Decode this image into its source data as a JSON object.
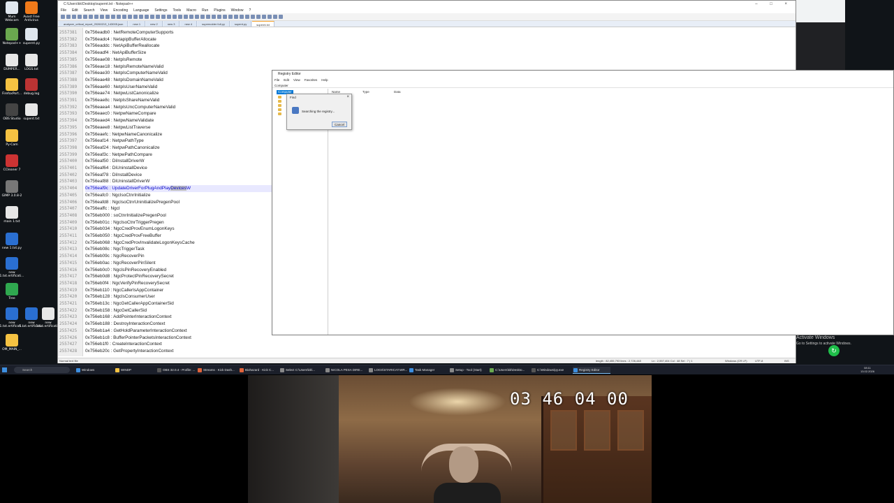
{
  "desktop": {
    "icons": [
      {
        "label": "Mum\nWebcam",
        "color": "#dfe6ee"
      },
      {
        "label": "Avast Free\nAntivirus",
        "color": "#f07a1a"
      },
      {
        "label": "Notepad++",
        "color": "#6aa84f"
      },
      {
        "label": "supernt.py",
        "color": "#dfe6ee"
      },
      {
        "label": "DUMPER...",
        "color": "#e7e7e7"
      },
      {
        "label": "LOGS.txt",
        "color": "#e7e7e7"
      },
      {
        "label": "FirefoxPort...",
        "color": "#f5c242"
      },
      {
        "label": "debug.log",
        "color": "#b33"
      },
      {
        "label": "OBS Studio",
        "color": "#444"
      },
      {
        "label": "supent.txt",
        "color": "#e7e7e7"
      },
      {
        "label": "Py-Cam",
        "color": "#f5c242"
      },
      {
        "label": "CCleaner 7",
        "color": "#c33"
      },
      {
        "label": "GIMP 3.0.8-2",
        "color": "#777"
      },
      {
        "label": "main 1.txt",
        "color": "#e7e7e7"
      },
      {
        "label": "new 1.txt.py",
        "color": "#2a6fd1"
      },
      {
        "label": "new\n1.txt.ertificati...",
        "color": "#2a6fd1"
      },
      {
        "label": "Tree",
        "color": "#2fa84f"
      },
      {
        "label": "new\n1.txt.ertificati...",
        "color": "#2a6fd1"
      },
      {
        "label": "new\n1.txt.ertificati...",
        "color": "#2a6fd1"
      },
      {
        "label": "new\n1.txt.ertificati...",
        "color": "#e7e7e7"
      },
      {
        "label": "OM_MAIN_...",
        "color": "#f5c242"
      }
    ],
    "activate_title": "Activate Windows",
    "activate_sub": "Go to Settings to activate Windows."
  },
  "notepad": {
    "title": "C:\\Users\\kk\\Desktop\\supernt.txt - Notepad++",
    "menu": [
      "File",
      "Edit",
      "Search",
      "View",
      "Encoding",
      "Language",
      "Settings",
      "Tools",
      "Macro",
      "Run",
      "Plugins",
      "Window",
      "?"
    ],
    "tabs": [
      {
        "label": "analyzer_critical_report_20260213_143005.json",
        "active": false
      },
      {
        "label": "new 1",
        "active": false
      },
      {
        "label": "new 2",
        "active": false
      },
      {
        "label": "new 3",
        "active": false
      },
      {
        "label": "new 4",
        "active": false
      },
      {
        "label": "supernolder full.py",
        "active": false
      },
      {
        "label": "supent.py",
        "active": false
      },
      {
        "label": "supernt.txt",
        "active": true
      }
    ],
    "lines": [
      {
        "n": "2557381",
        "t": "0x756eadb0 : NetRemoteComputerSupports"
      },
      {
        "n": "2557382",
        "t": "0x756eadc4 : NetapipBufferAllocate"
      },
      {
        "n": "2557383",
        "t": "0x756eaddc : NetApiBufferReallocate"
      },
      {
        "n": "2557384",
        "t": "0x756eadf4 : NetApiBufferSize"
      },
      {
        "n": "2557385",
        "t": "0x756eae08 : NetpIsRemote"
      },
      {
        "n": "2557386",
        "t": "0x756eae18 : NetpIsRemoteNameValid"
      },
      {
        "n": "2557387",
        "t": "0x756eae30 : NetpIsComputerNameValid"
      },
      {
        "n": "2557388",
        "t": "0x756eae48 : NetpIsDomainNameValid"
      },
      {
        "n": "2557389",
        "t": "0x756eae60 : NetpIsUserNameValid"
      },
      {
        "n": "2557390",
        "t": "0x756eae74 : NetpwListCanonicalize"
      },
      {
        "n": "2557391",
        "t": "0x756eae8c : NetpIsShareNameValid"
      },
      {
        "n": "2557392",
        "t": "0x756eaea4 : NetpIsUncComputerNameValid"
      },
      {
        "n": "2557393",
        "t": "0x756eaec0 : NetpwNameCompare"
      },
      {
        "n": "2557394",
        "t": "0x756eaed4 : NetpwNameValidate"
      },
      {
        "n": "2557395",
        "t": "0x756eaee8 : NetpwListTraverse"
      },
      {
        "n": "2557396",
        "t": "0x756eaefc : NetpwNameCanonicalize"
      },
      {
        "n": "2557397",
        "t": "0x756eaf14 : NetpwPathType"
      },
      {
        "n": "2557398",
        "t": "0x756eaf24 : NetpwPathCanonicalize"
      },
      {
        "n": "2557399",
        "t": "0x756eaf3c : NetpwPathCompare"
      },
      {
        "n": "2557400",
        "t": "0x756eaf50 : DiInstallDriverW"
      },
      {
        "n": "2557401",
        "t": "0x756eaf64 : DiUninstallDevice"
      },
      {
        "n": "2557402",
        "t": "0x756eaf78 : DiInstallDevice"
      },
      {
        "n": "2557403",
        "t": "0x756eaf88 : DiUninstallDriverW"
      },
      {
        "n": "2557404",
        "t": "0x756eaf9c : UpdateDriverForPlugAndPlayDevicesW"
      },
      {
        "n": "2557405",
        "t": "0x756eafc0 : NgcIsoCtnrInitialize"
      },
      {
        "n": "2557406",
        "t": "0x756eafd8 : NgcIsoCtnrUninitializePregenPool"
      },
      {
        "n": "2557407",
        "t": "0x756eaffc : NgcI"
      },
      {
        "n": "2557408",
        "t": "0x756eb000 : soCtnrInitializePregenPool"
      },
      {
        "n": "2557409",
        "t": "0x756eb01c : NgcIsoCtnrTriggerPregen"
      },
      {
        "n": "2557410",
        "t": "0x756eb034 : NgcCredProvEnumLogonKeys"
      },
      {
        "n": "2557411",
        "t": "0x756eb050 : NgcCredProvFreeBuffer"
      },
      {
        "n": "2557412",
        "t": "0x756eb068 : NgcCredProvInvalidateLogonKeysCache"
      },
      {
        "n": "2557413",
        "t": "0x756eb08c : NgcTriggerTask"
      },
      {
        "n": "2557414",
        "t": "0x756eb09c : NgcRecoverPin"
      },
      {
        "n": "2557415",
        "t": "0x756eb0ac : NgcRecoverPinSilent"
      },
      {
        "n": "2557416",
        "t": "0x756eb0c0 : NgcIsPinRecoveryEnabled"
      },
      {
        "n": "2557417",
        "t": "0x756eb0d8 : NgcProtectPinRecoverySecret"
      },
      {
        "n": "2557418",
        "t": "0x756eb0f4 : NgcVerifyPinRecoverySecret"
      },
      {
        "n": "2557419",
        "t": "0x756eb110 : NgcCallerIsAppContainer"
      },
      {
        "n": "2557420",
        "t": "0x756eb128 : NgcIsConsumerUser"
      },
      {
        "n": "2557421",
        "t": "0x756eb13c : NgcGetCallerAppContainerSid"
      },
      {
        "n": "2557422",
        "t": "0x756eb158 : NgcGetCallerSid"
      },
      {
        "n": "2557423",
        "t": "0x756eb168 : AddPointerInteractionContext"
      },
      {
        "n": "2557424",
        "t": "0x756eb188 : DestroyInteractionContext"
      },
      {
        "n": "2557425",
        "t": "0x756eb1a4 : GetHoldParameterInteractionContext"
      },
      {
        "n": "2557426",
        "t": "0x756eb1c8 : BufferPointerPacketsInteractionContext"
      },
      {
        "n": "2557427",
        "t": "0x756eb1f0 : CreateInteractionContext"
      },
      {
        "n": "2557428",
        "t": "0x756eb20c : GetPropertyInteractionContext"
      }
    ],
    "highlight_line": 23,
    "highlight_prefix": "0x756eaf9c : UpdateDriverForPlugAndPlay",
    "highlight_selected": "Devices",
    "highlight_suffix": "W",
    "status": {
      "type": "Normal text file",
      "length": "length : 82,455,793   lines : 2,726,448",
      "pos": "Ln : 2,557,404   Col : 48   Sel : 7 | 1",
      "eol": "Windows (CR LF)",
      "enc": "UTF-8",
      "ins": "INS"
    }
  },
  "regedit": {
    "title": "Registry Editor",
    "menu": [
      "File",
      "Edit",
      "View",
      "Favorites",
      "Help"
    ],
    "address": "Computer",
    "tree_root": "Computer",
    "columns": [
      "Name",
      "Type",
      "Data"
    ]
  },
  "find_dialog": {
    "title": "Find",
    "message": "Searching the registry...",
    "cancel": "Cancel",
    "close": "×"
  },
  "taskbar": {
    "search": "Search",
    "items": [
      {
        "label": "Windows",
        "color": "#3d8fe0"
      },
      {
        "label": "WINDP",
        "color": "#f5c242"
      },
      {
        "label": "OBS 32.0.4 - Profile: ...",
        "color": "#555"
      },
      {
        "label": "Streams · Kick Dash...",
        "color": "#e0633a"
      },
      {
        "label": "Biohazard · Kick C...",
        "color": "#e0633a"
      },
      {
        "label": "Select C:\\Users\\kk\\...",
        "color": "#888"
      },
      {
        "label": "NICOLA PESA DIRE...",
        "color": "#888"
      },
      {
        "label": "LOGS\\STARICAT.WR...",
        "color": "#888"
      },
      {
        "label": "Task Manager",
        "color": "#3d8fe0"
      },
      {
        "label": "Setup - Tool (Start)",
        "color": "#888"
      },
      {
        "label": "C:\\Users\\kk\\Deskto...",
        "color": "#6aa84f"
      },
      {
        "label": "C:\\Windows\\py.exe",
        "color": "#555"
      },
      {
        "label": "Registry Editor",
        "color": "#3d8fe0"
      }
    ],
    "time": "08:11",
    "date": "13.02.2026"
  },
  "webcam": {
    "timecode": "03 46 04 00"
  }
}
